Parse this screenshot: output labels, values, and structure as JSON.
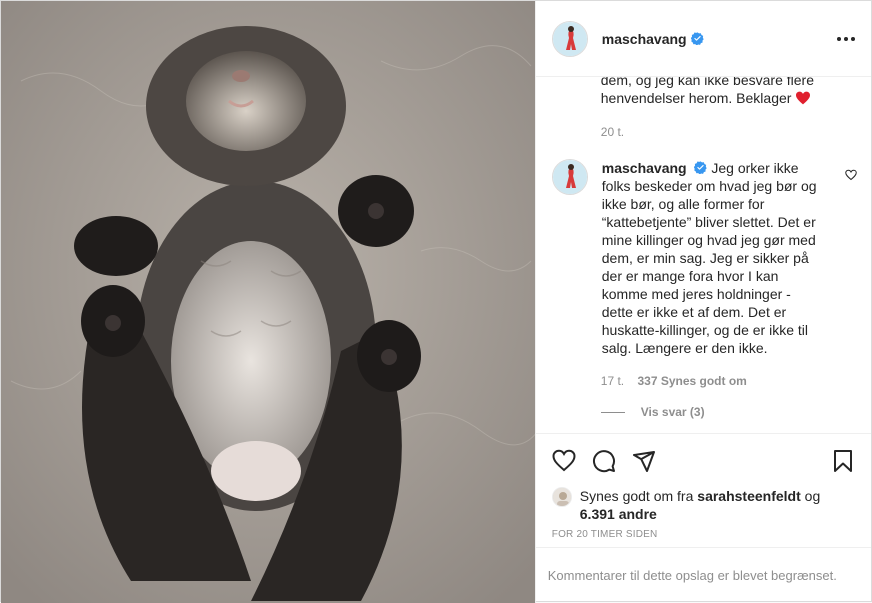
{
  "post": {
    "username": "maschavang",
    "verified": true,
    "photo_description": "kitten-photo"
  },
  "previous_comment": {
    "text_tail": "dem, og jeg kan ikke besvare flere henvendelser herom. Beklager",
    "time": "20 t."
  },
  "comment": {
    "username": "maschavang",
    "text": "Jeg orker ikke folks beskeder om hvad jeg bør og ikke bør, og alle former for “kattebetjente” bliver slettet. Det er mine killinger og hvad jeg gør med dem, er min sag. Jeg er sikker på der er mange fora hvor I kan komme med jeres holdninger - dette er ikke et af dem. Det er huskatte-killinger, og de er ikke til salg. Længere er den ikke.",
    "time": "17 t.",
    "likes": "337 Synes godt om",
    "view_replies": "Vis svar (3)"
  },
  "likes_row": {
    "prefix": "Synes godt om fra ",
    "liker": "sarahsteenfeldt",
    "middle": " og",
    "others": "6.391 andre"
  },
  "posted_time": "FOR 20 TIMER SIDEN",
  "comments_restricted": "Kommentarer til dette opslag er blevet begrænset.",
  "icons": {
    "more": "more-options-icon",
    "like": "heart-icon",
    "comment": "comment-icon",
    "share": "share-icon",
    "save": "bookmark-icon",
    "verified": "verified-badge-icon"
  },
  "colors": {
    "verified_blue": "#3897f0",
    "heart_red": "#ed4956",
    "muted": "#8e8e8e"
  }
}
